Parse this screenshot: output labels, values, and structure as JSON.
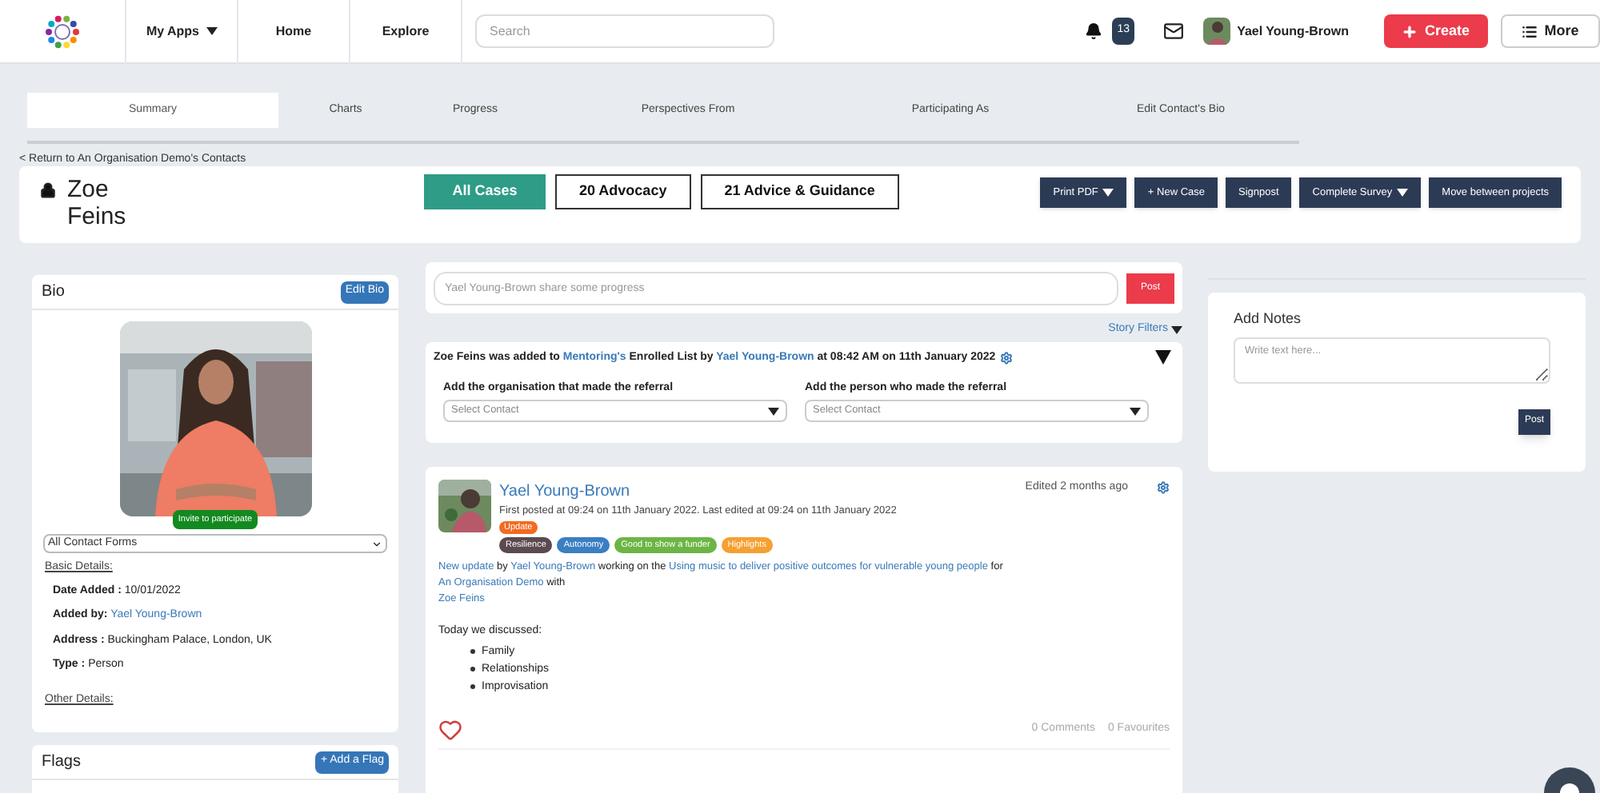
{
  "nav": {
    "menu": [
      {
        "label": "My Apps",
        "caret": true
      },
      {
        "label": "Home",
        "caret": false
      },
      {
        "label": "Explore",
        "caret": false
      }
    ],
    "search": {
      "placeholder": "Search"
    },
    "notifications": "13",
    "user": "Yael Young-Brown",
    "create": "Create",
    "more": "More"
  },
  "tabs": [
    {
      "label": "Summary",
      "selected": true
    },
    {
      "label": "Charts",
      "selected": false
    },
    {
      "label": "Progress",
      "selected": false
    },
    {
      "label": "Perspectives From",
      "selected": false
    },
    {
      "label": "Participating As",
      "selected": false
    },
    {
      "label": "Edit Contact's Bio",
      "selected": false
    }
  ],
  "back_link": "< Return to An Organisation Demo's Contacts",
  "contact": {
    "name": "Zoe Feins",
    "locked": true
  },
  "case_tabs": [
    {
      "label": "All Cases",
      "selected": true
    },
    {
      "label": "20 Advocacy",
      "selected": false
    },
    {
      "label": "21 Advice & Guidance",
      "selected": false
    }
  ],
  "actions": [
    {
      "label": "Print PDF",
      "dropdown": true
    },
    {
      "label": "+ New Case",
      "dropdown": false
    },
    {
      "label": "Signpost",
      "dropdown": false
    },
    {
      "label": "Complete Survey",
      "dropdown": true
    },
    {
      "label": "Move between projects",
      "dropdown": false
    }
  ],
  "bio": {
    "title": "Bio",
    "edit": "Edit Bio",
    "invite": "Invite to participate",
    "form_select": "All Contact Forms",
    "basic_heading": "Basic Details:",
    "details": [
      {
        "label": "Date Added :",
        "value": "10/01/2022",
        "kind": "text"
      },
      {
        "label": "Added by:",
        "value": "Yael Young-Brown",
        "kind": "link"
      },
      {
        "label": "Address :",
        "value": "Buckingham Palace, London, UK",
        "kind": "text"
      },
      {
        "label": "Type :",
        "value": "Person",
        "kind": "text"
      }
    ],
    "other_heading": "Other Details:"
  },
  "flags": {
    "title": "Flags",
    "button": "+ Add a Flag"
  },
  "composer": {
    "placeholder": "Yael Young-Brown share some progress",
    "button": "Post"
  },
  "story_filters": "Story Filters",
  "enrollment": {
    "parts": [
      {
        "text": "Zoe Feins was added to",
        "link": false
      },
      {
        "text": "Mentoring's",
        "link": true
      },
      {
        "text": "Enrolled List by",
        "link": false
      },
      {
        "text": "Yael Young-Brown",
        "link": true
      },
      {
        "text": "at 08:42 AM on 11th January 2022",
        "link": false
      }
    ],
    "fields": [
      {
        "label": "Add the organisation that made the referral",
        "placeholder": "Select Contact"
      },
      {
        "label": "Add the person who made the referral",
        "placeholder": "Select Contact"
      }
    ]
  },
  "post": {
    "author": "Yael Young-Brown",
    "meta": "First posted at 09:24 on 11th January 2022. Last edited at 09:24 on 11th January 2022",
    "edited": "Edited 2 months ago",
    "type_tag": {
      "label": "Update",
      "color": "#f26b21"
    },
    "tags": [
      {
        "label": "Resilience",
        "color": "#5b4a4f"
      },
      {
        "label": "Autonomy",
        "color": "#3b7ec2"
      },
      {
        "label": "Good to show a funder",
        "color": "#6cb545"
      },
      {
        "label": "Highlights",
        "color": "#f5a031"
      }
    ],
    "body": [
      {
        "text": "New update",
        "link": true
      },
      {
        "text": "by",
        "link": false
      },
      {
        "text": "Yael Young-Brown",
        "link": true
      },
      {
        "text": "working on the",
        "link": false
      },
      {
        "text": "Using music to deliver positive outcomes for vulnerable young people",
        "link": true
      },
      {
        "text": "for",
        "link": false
      },
      {
        "text": "An Organisation Demo",
        "link": true
      },
      {
        "text": "with",
        "link": false
      }
    ],
    "with_contact": "Zoe Feins",
    "intro": "Today we discussed:",
    "list": [
      "Family",
      "Relationships",
      "Improvisation"
    ],
    "comments": "0 Comments",
    "favourites": "0 Favourites"
  },
  "notes": {
    "title": "Add Notes",
    "placeholder": "Write text here...",
    "button": "Post"
  }
}
